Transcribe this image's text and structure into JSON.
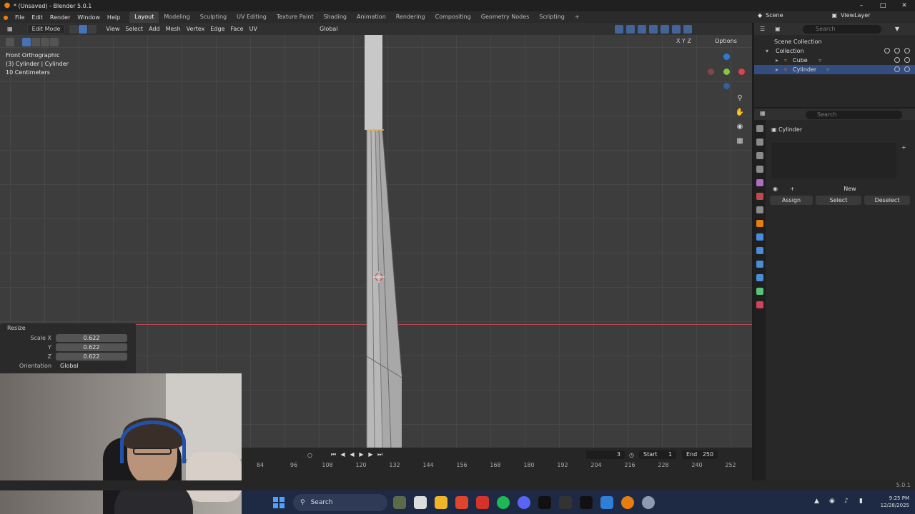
{
  "window": {
    "title": "* (Unsaved) - Blender 5.0.1",
    "controls": [
      "–",
      "□",
      "✕"
    ]
  },
  "menu": [
    "File",
    "Edit",
    "Render",
    "Window",
    "Help"
  ],
  "workspaces": [
    "Layout",
    "Modeling",
    "Sculpting",
    "UV Editing",
    "Texture Paint",
    "Shading",
    "Animation",
    "Rendering",
    "Compositing",
    "Geometry Nodes",
    "Scripting",
    "+"
  ],
  "scene": {
    "name": "Scene",
    "view_layer": "ViewLayer"
  },
  "viewport_header": {
    "mode": "Edit Mode",
    "menus": [
      "View",
      "Select",
      "Add",
      "Mesh",
      "Vertex",
      "Edge",
      "Face",
      "UV"
    ],
    "transform_orientation": "Global",
    "options": "Options",
    "axes": "X Y Z"
  },
  "viewport": {
    "overlay_lines": [
      "Front Orthographic",
      "(3) Cylinder | Cylinder",
      "10 Centimeters"
    ]
  },
  "resize_panel": {
    "title": "Resize",
    "rows": [
      {
        "label": "Scale X",
        "value": "0.622"
      },
      {
        "label": "Y",
        "value": "0.622"
      },
      {
        "label": "Z",
        "value": "0.622"
      },
      {
        "label": "Orientation",
        "value": "Global"
      }
    ]
  },
  "timeline": {
    "current_frame": "3",
    "start_label": "Start",
    "start": "1",
    "end_label": "End",
    "end": "250",
    "ticks": [
      "84",
      "96",
      "108",
      "120",
      "132",
      "144",
      "156",
      "168",
      "180",
      "192",
      "204",
      "216",
      "228",
      "240",
      "252"
    ]
  },
  "outliner": {
    "search_placeholder": "Search",
    "scene_collection": "Scene Collection",
    "collection": "Collection",
    "items": [
      "Cube",
      "Cylinder"
    ]
  },
  "properties": {
    "search_placeholder": "Search",
    "object": "Cylinder",
    "new_label": "New",
    "assign_label": "Assign",
    "select_label": "Select",
    "deselect_label": "Deselect"
  },
  "status": {
    "version": "5.0.1"
  },
  "taskbar": {
    "search": "Search",
    "time": "9:25 PM",
    "date": "12/28/2025"
  },
  "colors": {
    "accent": "#4772b3",
    "x_axis": "#b54a52",
    "selection": "#334d80",
    "orange": "#e87d0d"
  }
}
